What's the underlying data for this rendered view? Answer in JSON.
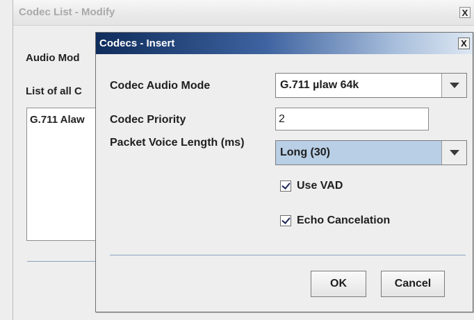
{
  "outer_window": {
    "title": "Codec List - Modify",
    "close_glyph": "X",
    "audio_mode_label": "Audio Mod",
    "list_label": "List of all C",
    "list_items": [
      "G.711 Alaw"
    ]
  },
  "dialog": {
    "title": "Codecs - Insert",
    "close_glyph": "X",
    "codec_audio_mode": {
      "label": "Codec Audio Mode",
      "value": "G.711 µlaw 64k"
    },
    "codec_priority": {
      "label": "Codec Priority",
      "value": "2"
    },
    "packet_voice_length": {
      "label": "Packet Voice Length (ms)",
      "value": "Long (30)"
    },
    "use_vad": {
      "label": "Use VAD",
      "checked": true
    },
    "echo_cancelation": {
      "label": "Echo Cancelation",
      "checked": true
    },
    "buttons": {
      "ok": "OK",
      "cancel": "Cancel"
    }
  },
  "colors": {
    "dialog_title_gradient_start": "#0f2d5c",
    "combo_selected_bg": "#b8cfe5",
    "divider": "#8aa2bd"
  },
  "icons": [
    "close-icon",
    "dropdown-arrow-icon",
    "checkmark-icon"
  ]
}
